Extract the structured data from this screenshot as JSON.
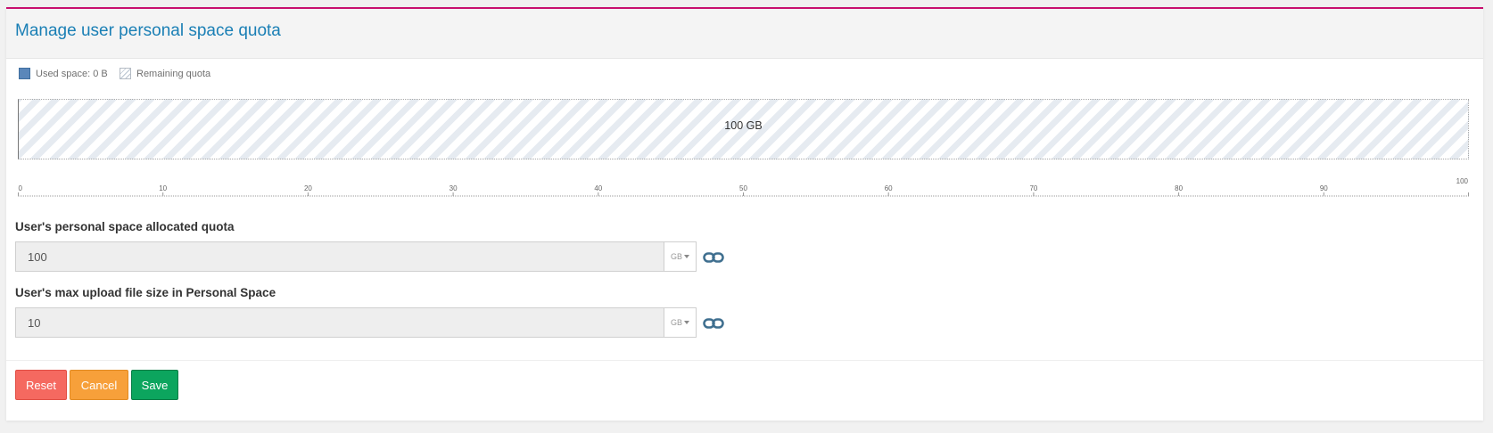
{
  "panel": {
    "title": "Manage user personal space quota"
  },
  "legend": {
    "used_label": "Used space: 0 B",
    "remaining_label": "Remaining quota",
    "used_color": "#5a87ba",
    "remaining_color": "#b9c4d0"
  },
  "quota_bar": {
    "label": "100 GB",
    "used_fraction": 0
  },
  "ruler": {
    "ticks": [
      "0",
      "10",
      "20",
      "30",
      "40",
      "50",
      "60",
      "70",
      "80",
      "90",
      "100"
    ]
  },
  "allocated_quota": {
    "label": "User's personal space allocated quota",
    "value": "100",
    "unit": "GB",
    "link_icon": "link-icon"
  },
  "max_upload": {
    "label": "User's max upload file size in Personal Space",
    "value": "10",
    "unit": "GB",
    "link_icon": "link-icon"
  },
  "actions": {
    "reset_label": "Reset",
    "cancel_label": "Cancel",
    "save_label": "Save"
  },
  "colors": {
    "accent": "#c8106f",
    "title": "#1a7fb5",
    "reset": "#f56960",
    "cancel": "#f7a03a",
    "save": "#0ca55e",
    "link_icon": "#3f6f8f"
  }
}
